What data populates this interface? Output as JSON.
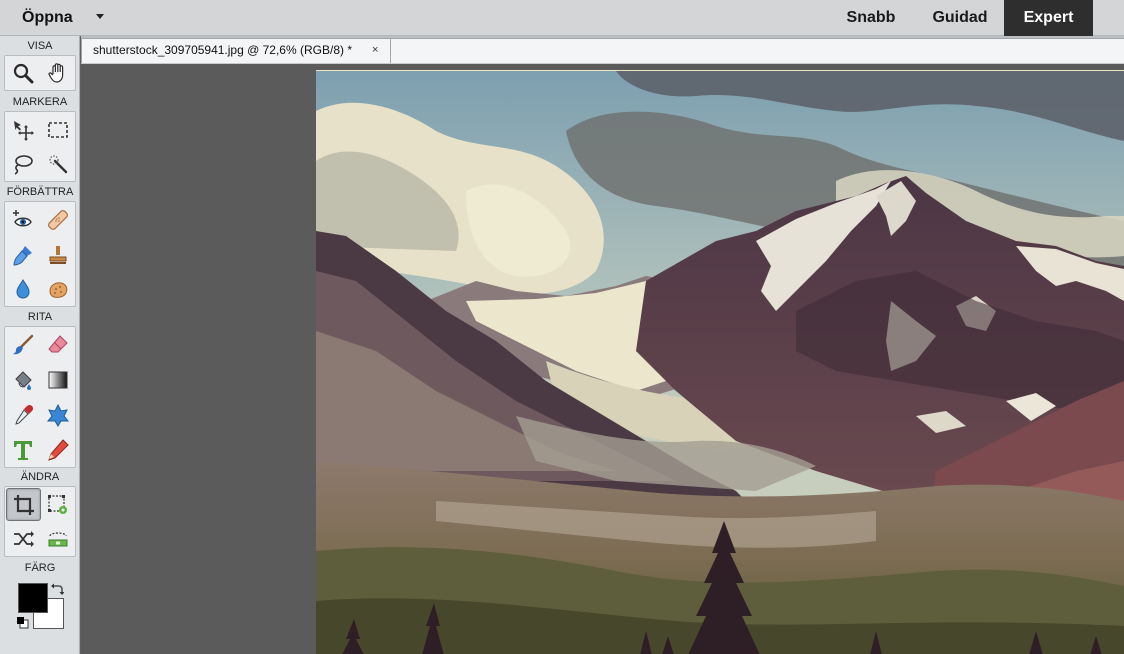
{
  "topbar": {
    "open_label": "Öppna",
    "modes": [
      "Snabb",
      "Guidad",
      "Expert"
    ],
    "active_mode": "Expert"
  },
  "toolbox": {
    "sections": {
      "view": "VISA",
      "select": "MARKERA",
      "enhance": "FÖRBÄTTRA",
      "draw": "RITA",
      "modify": "ÄNDRA",
      "color": "FÄRG"
    },
    "tools": {
      "view": [
        "zoom-icon",
        "hand-icon"
      ],
      "select": [
        "move-icon",
        "marquee-icon",
        "lasso-icon",
        "quick-selection-icon"
      ],
      "enhance": [
        "red-eye-icon",
        "spot-healing-icon",
        "smart-brush-icon",
        "clone-stamp-icon",
        "blur-icon",
        "sponge-icon"
      ],
      "draw": [
        "brush-icon",
        "eraser-icon",
        "paint-bucket-icon",
        "gradient-icon",
        "eyedropper-icon",
        "custom-shape-icon",
        "type-icon",
        "pencil-icon"
      ],
      "modify": [
        "crop-icon",
        "recompose-icon",
        "content-aware-move-icon",
        "straighten-icon"
      ]
    },
    "selected_tool": "crop-icon",
    "foreground_color": "#000000",
    "background_color": "#ffffff"
  },
  "document": {
    "tab_title": "shutterstock_309705941.jpg @ 72,6% (RGB/8) *",
    "close_glyph": "×",
    "zoom": "72,6%"
  },
  "colors": {
    "active_mode_bg": "#2e2e2e",
    "workspace_bg": "#5b5b5b"
  }
}
